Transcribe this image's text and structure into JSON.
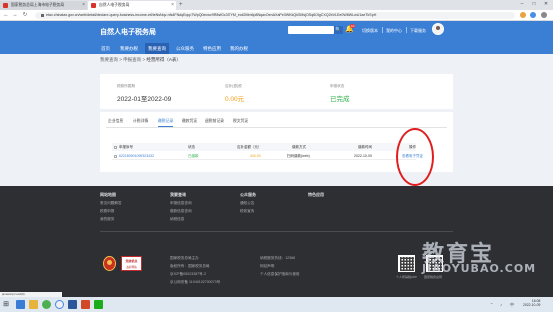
{
  "browser": {
    "tabs": [
      {
        "title": "国家税务总局上海市电子税务局"
      },
      {
        "title": "自然人电子税务局"
      }
    ],
    "new_tab": "+",
    "window_controls": [
      "–",
      "□",
      "✕"
    ],
    "back": "←",
    "forward": "→",
    "reload": "↻",
    "url": "etax.chinatax.gov.cn/web/detail/declare-query-business-income-etl/ieNsNqv-nfs4FNdqEqcp7WpQ0ecwv9R8sfGc3l7YM_eoil2Mm6p8NqaxOenAXaPe3WKkQkSMsjOSq6OlgCXQ2bVLEe0W8WLwU1aeTkSpH"
  },
  "site": {
    "title": "自然人电子税务局",
    "search_button": "🔍",
    "bell_icon": "🔔",
    "notification_count": "10",
    "header_links": [
      "切换版本",
      "我的中心",
      "下载服务"
    ],
    "main_nav": [
      {
        "label": "首页",
        "active": false
      },
      {
        "label": "我要办税",
        "active": false
      },
      {
        "label": "我要查询",
        "active": true
      },
      {
        "label": "公众服务",
        "active": false
      },
      {
        "label": "特色应用",
        "active": false
      },
      {
        "label": "我的办税",
        "active": false
      }
    ]
  },
  "breadcrumb": {
    "items": [
      "我要查询",
      "申报查询",
      "经营所得（A表）"
    ],
    "separator": ">"
  },
  "summary": {
    "period_label": "税款所属期",
    "period_value": "2022-01至2022-09",
    "tax_label": "应补(退)税",
    "tax_value": "0.00元",
    "status_label": "申报状态",
    "status_value": "已完成"
  },
  "record_tabs": [
    {
      "label": "企业信息",
      "active": false
    },
    {
      "label": "计税详情",
      "active": false
    },
    {
      "label": "缴税记录",
      "active": true
    },
    {
      "label": "缴款凭证",
      "active": false
    },
    {
      "label": "退税前记录",
      "active": false
    },
    {
      "label": "税文凭证",
      "active": false
    }
  ],
  "table": {
    "headers": [
      "申报序号",
      "状态",
      "应补金额（元）",
      "缴款方式",
      "缴款时间",
      "操作"
    ],
    "row": {
      "serial": "622180901099323432",
      "status": "已缴款",
      "amount": "400.00",
      "method": "扫码缴款(web)",
      "time": "2022-10-09",
      "action": "查看电子凭证"
    }
  },
  "footer": {
    "columns": [
      {
        "title": "网站地图",
        "links": [
          "常见问题解答",
          "税费申报",
          "我的服务"
        ]
      },
      {
        "title": "我要查询",
        "links": [
          "申报信息查询",
          "缴款信息查询",
          "纳税信息"
        ]
      },
      {
        "title": "公众服务",
        "links": [
          "通知公告",
          "税收宣传"
        ]
      },
      {
        "title": "特色应用",
        "links": []
      }
    ],
    "badge_top": "党政机关",
    "badge_bottom": "政府网站",
    "info_left": [
      "国家税务总局主办",
      "版权所有：国家税务总局",
      "京ICP备05023387号-2",
      "京公网安备 11040102700073号"
    ],
    "info_right": [
      "纳税服务热线：12366",
      "网站声明",
      "个人信息保护指南与使用"
    ],
    "qr_captions": [
      "个人所得税APP",
      "国家税务总局"
    ],
    "watermark_main": "教育宝",
    "watermark_sub": "JIAOYUBAO.COM",
    "status_url": "javascript:void(0)"
  },
  "taskbar": {
    "time": "16:08",
    "date": "2022-10-09"
  },
  "colors": {
    "brand_blue": "#3b7fd4",
    "success_green": "#2fb24b",
    "amount_orange": "#f39c12",
    "annotation_red": "#e01e1e"
  }
}
